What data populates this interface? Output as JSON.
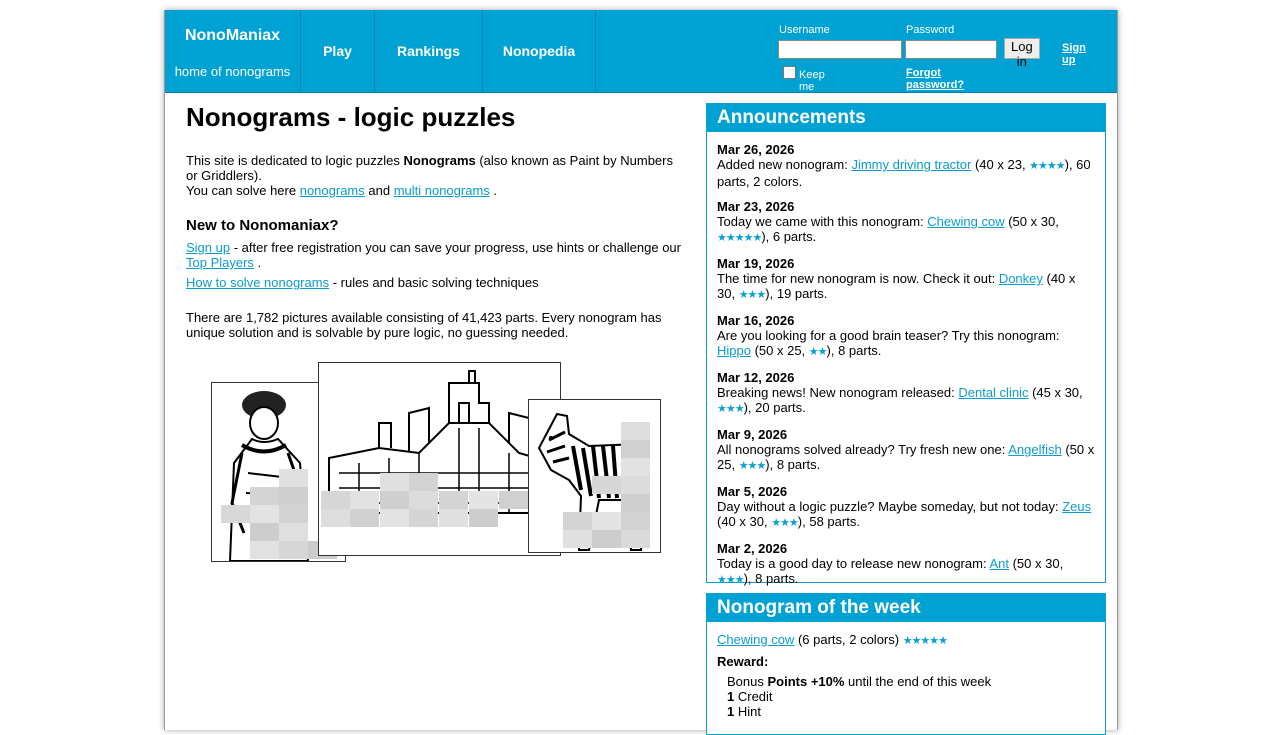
{
  "header": {
    "brand_name": "NonoManiax",
    "brand_tag": "home of nonograms",
    "nav": [
      "Play",
      "Rankings",
      "Nonopedia"
    ],
    "username_label": "Username",
    "password_label": "Password",
    "login_button": "Log in",
    "signup_link": "Sign up",
    "keep_logged": "Keep me logged in",
    "forgot_link": "Forgot password?"
  },
  "main": {
    "title": "Nonograms - logic puzzles",
    "intro_1": "This site is dedicated to logic puzzles ",
    "intro_bold": "Nonograms",
    "intro_2": " (also known as Paint by Numbers or Griddlers).",
    "intro_3": "You can solve here ",
    "link_nonograms": "nonograms",
    "intro_and": " and ",
    "link_multi": "multi nonograms",
    "intro_dot": " .",
    "new_heading": "New to Nonomaniax?",
    "signup_link": "Sign up",
    "signup_text": " - after free registration you can save your progress, use hints or challenge our ",
    "top_players_link": "Top Players",
    "signup_end": " .",
    "howto_link": "How to solve nonograms",
    "howto_text": " - rules and basic solving techniques",
    "stats": "There are 1,782 pictures available consisting of 41,423 parts. Every nonogram has unique solution and is solvable by pure logic, no guessing needed."
  },
  "announcements": {
    "title": "Announcements",
    "items": [
      {
        "date": "Mar 26, 2026",
        "pre": "Added new nonogram: ",
        "link": "Jimmy driving tractor",
        "mid": " (40 x 23, ",
        "stars": "★★★★",
        "post": "), 60 parts, 2 colors."
      },
      {
        "date": "Mar 23, 2026",
        "pre": "Today we came with this nonogram: ",
        "link": "Chewing cow",
        "mid": " (50 x 30, ",
        "stars": "★★★★★",
        "post": "), 6 parts."
      },
      {
        "date": "Mar 19, 2026",
        "pre": "The time for new nonogram is now. Check it out: ",
        "link": "Donkey",
        "mid": " (40 x 30, ",
        "stars": "★★★",
        "post": "), 19 parts."
      },
      {
        "date": "Mar 16, 2026",
        "pre": "Are you looking for a good brain teaser? Try this nonogram: ",
        "link": "Hippo",
        "mid": " (50 x 25, ",
        "stars": "★★",
        "post": "), 8 parts."
      },
      {
        "date": "Mar 12, 2026",
        "pre": "Breaking news! New nonogram released: ",
        "link": "Dental clinic",
        "mid": " (45 x 30, ",
        "stars": "★★★",
        "post": "), 20 parts."
      },
      {
        "date": "Mar 9, 2026",
        "pre": "All nonograms solved already? Try fresh new one: ",
        "link": "Angelfish",
        "mid": " (50 x 25, ",
        "stars": "★★★",
        "post": "), 8 parts."
      },
      {
        "date": "Mar 5, 2026",
        "pre": "Day without a logic puzzle? Maybe someday, but not today: ",
        "link": "Zeus",
        "mid": " (40 x 30, ",
        "stars": "★★★",
        "post": "), 58 parts."
      },
      {
        "date": "Mar 2, 2026",
        "pre": "Today is a good day to release new nonogram: ",
        "link": "Ant",
        "mid": " (50 x 30, ",
        "stars": "★★★",
        "post": "), 8 parts."
      }
    ]
  },
  "week": {
    "title": "Nonogram of the week",
    "link": "Chewing cow",
    "info": " (6 parts, 2 colors) ",
    "stars": "★★★★★",
    "reward_label": "Reward:",
    "bonus_pre": "Bonus ",
    "bonus_bold": "Points +10%",
    "bonus_post": " until the end of this week",
    "credit_num": "1",
    "credit_label": " Credit",
    "hint_num": "1",
    "hint_label": " Hint"
  },
  "colors": {
    "accent": "#00a2d4",
    "link": "#0a9ccb"
  }
}
